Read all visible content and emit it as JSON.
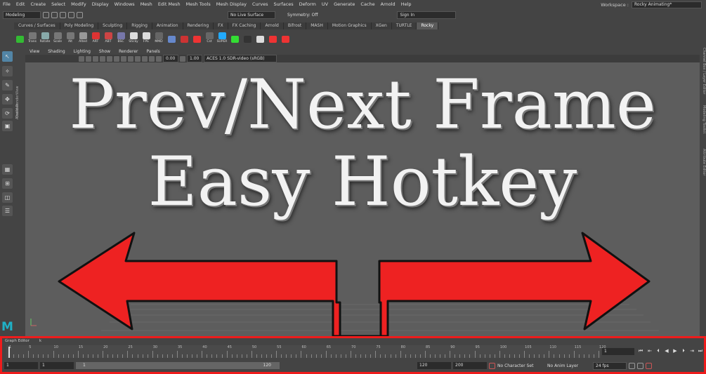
{
  "menubar": {
    "items": [
      "File",
      "Edit",
      "Create",
      "Select",
      "Modify",
      "Display",
      "Windows",
      "Mesh",
      "Edit Mesh",
      "Mesh Tools",
      "Mesh Display",
      "Curves",
      "Surfaces",
      "Deform",
      "UV",
      "Generate",
      "Cache",
      "Arnold",
      "Help"
    ],
    "workspace_label": "Workspace :",
    "workspace_value": "Rocky Animating*"
  },
  "status": {
    "mode": "Modeling",
    "live_surface": "No Live Surface",
    "symmetry": "Symmetry: Off",
    "sign_in": "Sign In"
  },
  "shelf_tabs": [
    "Curves / Surfaces",
    "Poly Modeling",
    "Sculpting",
    "Rigging",
    "Animation",
    "Rendering",
    "FX",
    "FX Caching",
    "Arnold",
    "Bifrost",
    "MASH",
    "Motion Graphics",
    "XGen",
    "TURTLE",
    "Rocky"
  ],
  "shelf_tab_active": "Rocky",
  "shelf_buttons": [
    "",
    "Trans",
    "Rotate",
    "Scale",
    "Alt",
    "Alted",
    "ART",
    "ABT",
    "BSC",
    "Sticky",
    "FPE",
    "MMD",
    "",
    "",
    "",
    "Cst",
    "SUPER",
    "",
    "",
    "",
    "",
    ""
  ],
  "panel_menu": [
    "View",
    "Shading",
    "Lighting",
    "Show",
    "Renderer",
    "Panels"
  ],
  "panel_toolbar": {
    "val1": "0.00",
    "val2": "1.00",
    "colorspace": "ACES 1.0 SDR-video (sRGB)"
  },
  "side_labels": {
    "outliner": "Outliner",
    "left2": "Arnold RenderView",
    "right1": "Channel Box / Layer Editor",
    "right2": "Modeling Toolkit",
    "right3": "Attribute Editor"
  },
  "headline": {
    "line1": "Prev/Next Frame",
    "line2": "Easy Hotkey"
  },
  "colors": {
    "arrow_red": "#ee2222",
    "timeline_border": "#ee1c1c",
    "maya_teal": "#1fb1c6"
  },
  "timeline": {
    "tabs": [
      "Graph Editor",
      "k"
    ],
    "ticks": [
      "1",
      "5",
      "10",
      "15",
      "20",
      "25",
      "30",
      "35",
      "40",
      "45",
      "50",
      "55",
      "60",
      "65",
      "70",
      "75",
      "80",
      "85",
      "90",
      "95",
      "100",
      "105",
      "110",
      "115",
      "120"
    ],
    "current_frame": "1",
    "range_start": "1",
    "range_inner_start": "1",
    "slider_start": "1",
    "slider_end": "120",
    "range_end": "120",
    "range_outer_end": "200",
    "character_set": "No Character Set",
    "anim_layer": "No Anim Layer",
    "fps": "24 fps"
  },
  "icons": [
    "maya-logo",
    "select-arrow-icon",
    "lasso-icon",
    "paint-icon",
    "move-icon",
    "rotate-icon",
    "scale-icon",
    "play-icon",
    "prev-frame-icon",
    "next-frame-icon"
  ]
}
